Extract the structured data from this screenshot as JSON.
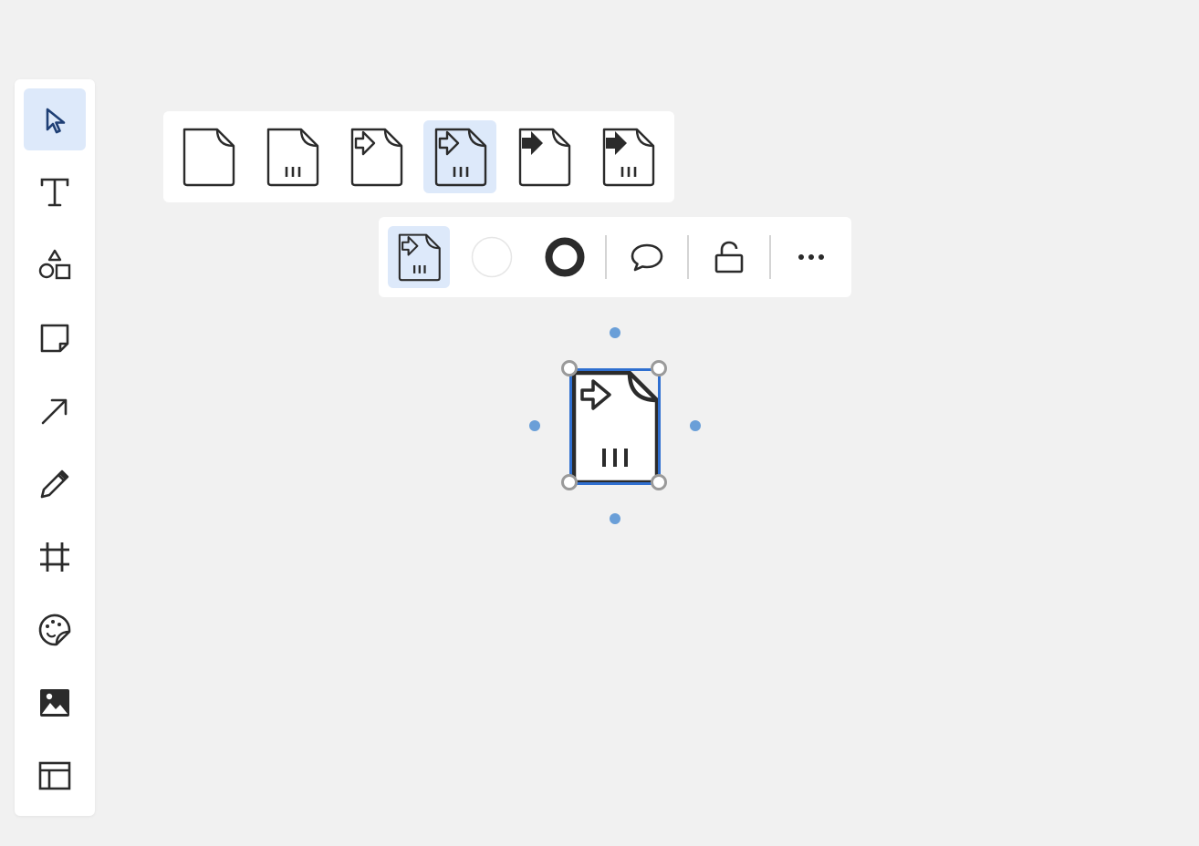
{
  "toolbar": {
    "tools": [
      {
        "name": "select-tool",
        "icon": "pointer-arrow-icon",
        "active": true
      },
      {
        "name": "text-tool",
        "icon": "text-t-icon"
      },
      {
        "name": "shapes-tool",
        "icon": "shapes-icon"
      },
      {
        "name": "sticky-note-tool",
        "icon": "sticky-note-icon"
      },
      {
        "name": "connector-tool",
        "icon": "diagonal-arrow-icon"
      },
      {
        "name": "pen-tool",
        "icon": "pencil-icon"
      },
      {
        "name": "frame-tool",
        "icon": "frame-hash-icon"
      },
      {
        "name": "sticker-tool",
        "icon": "sticker-face-icon"
      },
      {
        "name": "image-tool",
        "icon": "image-icon"
      },
      {
        "name": "template-tool",
        "icon": "layout-template-icon"
      }
    ]
  },
  "shape_variants": {
    "items": [
      {
        "name": "document-plain",
        "icon": "document-icon"
      },
      {
        "name": "document-with-bars",
        "icon": "document-bars-icon"
      },
      {
        "name": "document-with-arrow-outline",
        "icon": "document-arrow-outline-icon"
      },
      {
        "name": "document-with-arrow-outline-and-bars",
        "icon": "document-arrow-outline-bars-icon",
        "selected": true
      },
      {
        "name": "document-with-arrow-filled",
        "icon": "document-arrow-filled-icon"
      },
      {
        "name": "document-with-arrow-filled-and-bars",
        "icon": "document-arrow-filled-bars-icon"
      }
    ]
  },
  "context_toolbar": {
    "items": [
      {
        "name": "shape-type-button",
        "icon": "document-arrow-outline-bars-icon"
      },
      {
        "name": "fill-color-button",
        "icon": "fill-swatch-icon",
        "color": "#ffffff"
      },
      {
        "name": "stroke-color-button",
        "icon": "stroke-ring-icon",
        "color": "#2b2b2b"
      },
      {
        "name": "comment-button",
        "icon": "speech-bubble-icon"
      },
      {
        "name": "lock-button",
        "icon": "unlock-icon"
      },
      {
        "name": "more-options-button",
        "icon": "ellipsis-icon"
      }
    ]
  },
  "canvas": {
    "selected_shape": {
      "type": "document-with-arrow-outline-and-bars",
      "stroke": "#2b2b2b",
      "fill": "#ffffff"
    },
    "selection_color": "#2f6fd0"
  },
  "colors": {
    "background": "#f1f1f1",
    "panel": "#ffffff",
    "active_highlight": "#dde9fa",
    "icon": "#2b2b2b",
    "active_icon": "#1e3f75"
  }
}
